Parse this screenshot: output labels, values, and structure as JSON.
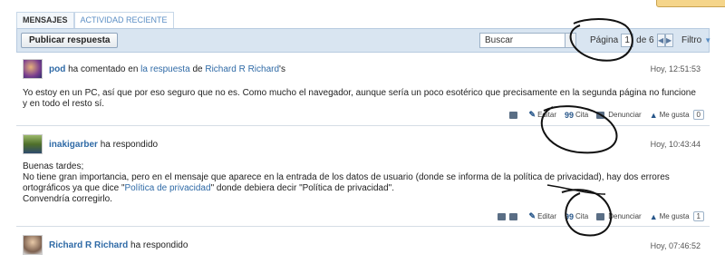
{
  "tabs": [
    {
      "label": "MENSAJES"
    },
    {
      "label": "ACTIVIDAD RECIENTE"
    }
  ],
  "toolbar": {
    "reply_label": "Publicar respuesta",
    "search_placeholder": "Buscar",
    "page_label": "Página",
    "current_page": "1",
    "of_label": "de 6",
    "prev": "◀",
    "next": "▶",
    "filter_label": "Filtro",
    "filter_caret": "▼"
  },
  "posts": [
    {
      "author": "pod",
      "action_pre": "ha comentado en",
      "action_link": "la respuesta",
      "action_mid": "de",
      "target": "Richard R Richard",
      "action_post": "'s",
      "time": "Hoy, 12:51:53",
      "lines": [
        "Yo estoy en un PC, así que por eso seguro que no es. Como mucho el navegador, aunque sería un poco esotérico que precisamente en la segunda página no funcione y en todo el resto sí."
      ],
      "edit": "Editar",
      "quote": "Cita",
      "report": "Denunciar",
      "like": "Me gusta",
      "likes": "0"
    },
    {
      "author": "inakigarber",
      "action_pre": "ha respondido",
      "time": "Hoy, 10:43:44",
      "lines": [
        "Buenas tardes;",
        "No tiene gran importancia, pero en el mensaje que aparece en la entrada de los datos de usuario (donde se informa de la política de privacidad), hay dos errores ortográficos ya que dice \"",
        "Política de privacidad",
        "\" donde debiera decir \"Política de privacidad\".",
        "Convendría corregirlo."
      ],
      "edit": "Editar",
      "quote": "Cita",
      "report": "Denunciar",
      "like": "Me gusta",
      "likes": "1"
    },
    {
      "author": "Richard R Richard",
      "action_pre": "ha respondido",
      "time": "Hoy, 07:46:52"
    }
  ],
  "icons": {
    "quote_glyph": "99",
    "edit_glyph": "✎",
    "like_glyph": "👍"
  }
}
